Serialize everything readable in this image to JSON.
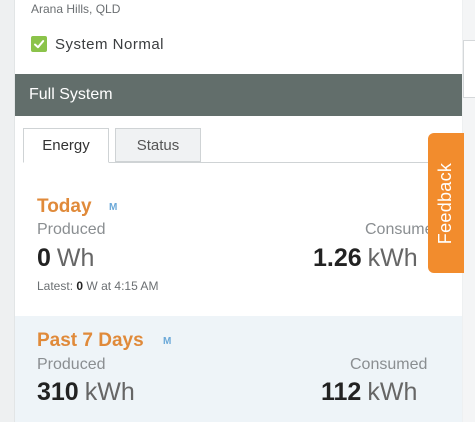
{
  "header": {
    "location": "Arana Hills, QLD",
    "status_text": "System Normal"
  },
  "band": {
    "title": "Full System"
  },
  "tabs": [
    {
      "label": "Energy",
      "active": true
    },
    {
      "label": "Status",
      "active": false
    }
  ],
  "today": {
    "title": "Today",
    "badge": "M",
    "produced_label": "Produced",
    "produced_value": "0",
    "produced_unit": "Wh",
    "consumed_label": "Consumed",
    "consumed_value": "1.26",
    "consumed_unit": "kWh",
    "latest_prefix": "Latest:",
    "latest_value": "0",
    "latest_suffix": "W at 4:15 AM"
  },
  "past": {
    "title": "Past 7 Days",
    "badge": "M",
    "produced_label": "Produced",
    "produced_value": "310",
    "produced_unit": "kWh",
    "consumed_label": "Consumed",
    "consumed_value": "112",
    "consumed_unit": "kWh"
  },
  "feedback": {
    "label": "Feedback"
  },
  "colors": {
    "accent": "#e08a3a",
    "band": "#626e6b",
    "status_ok": "#8bc34a",
    "feedback": "#f28c2d"
  },
  "icons": {
    "status": "check-icon"
  }
}
